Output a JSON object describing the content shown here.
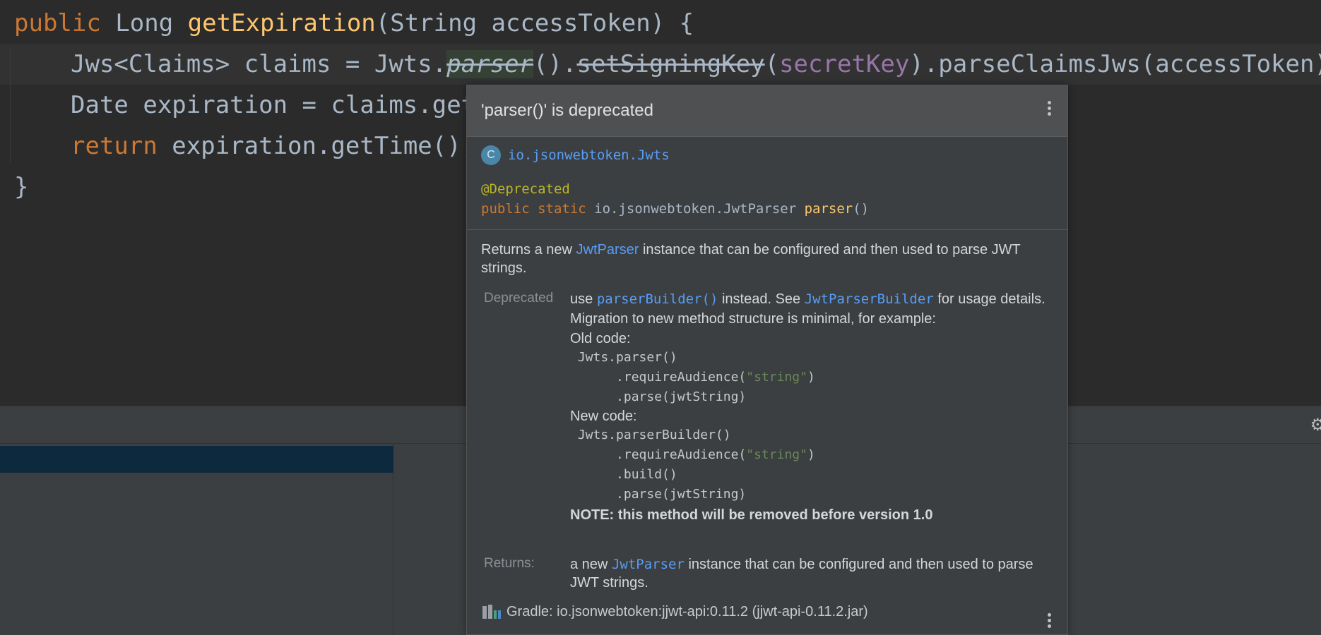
{
  "editor": {
    "line1": {
      "kw_public": "public",
      "type_long": " Long ",
      "method": "getExpiration",
      "params": "(String accessToken) {"
    },
    "line2": {
      "pre": "Jws<Claims> claims = Jwts.",
      "parser": "parser",
      "mid": "().",
      "setSigningKey": "setSigningKey",
      "paren_open": "(",
      "secretKey": "secretKey",
      "rest": ").parseClaimsJws(accessToken)",
      "semicolon": ";"
    },
    "line3": {
      "text": "Date expiration = claims.get"
    },
    "line4": {
      "kw_return": "return",
      "rest": " expiration.getTime()",
      "semicolon": ";"
    },
    "line5": {
      "text": "}"
    }
  },
  "popup": {
    "title": "'parser()' is deprecated",
    "class_icon_letter": "C",
    "class_name": "io.jsonwebtoken.Jwts",
    "annotation": "@Deprecated",
    "signature": {
      "kw": "public static",
      "type": " io.jsonwebtoken.JwtParser ",
      "method": "parser",
      "parens": "()"
    },
    "description": {
      "pre": "Returns a new ",
      "link": "JwtParser",
      "post": " instance that can be configured and then used to parse JWT strings."
    },
    "deprecated": {
      "label": "Deprecated",
      "use": "use ",
      "link1": "parserBuilder()",
      "mid": " instead. See ",
      "link2": "JwtParserBuilder",
      "post": " for usage details.",
      "migration": "Migration to new method structure is minimal, for example:",
      "old_code_label": "Old code:",
      "old_code": {
        "l1": " Jwts.parser()",
        "l2_pre": "      .requireAudience(",
        "l2_str": "\"string\"",
        "l2_post": ")",
        "l3": "      .parse(jwtString)"
      },
      "new_code_label": "New code:",
      "new_code": {
        "l1": " Jwts.parserBuilder()",
        "l2_pre": "      .requireAudience(",
        "l2_str": "\"string\"",
        "l2_post": ")",
        "l3": "      .build()",
        "l4": "      .parse(jwtString)"
      },
      "note": "NOTE: this method will be removed before version 1.0"
    },
    "returns": {
      "label": "Returns:",
      "pre": "a new ",
      "link": "JwtParser",
      "post": " instance that can be configured and then used to parse JWT strings."
    },
    "gradle": "Gradle: io.jsonwebtoken:jjwt-api:0.11.2 (jjwt-api-0.11.2.jar)"
  },
  "colors": {
    "editor_bg": "#2b2b2b",
    "keyword": "#cc7832",
    "method": "#ffc66d",
    "field": "#9876aa",
    "link": "#589df6",
    "annotation": "#bbb529",
    "string": "#6a8759"
  }
}
